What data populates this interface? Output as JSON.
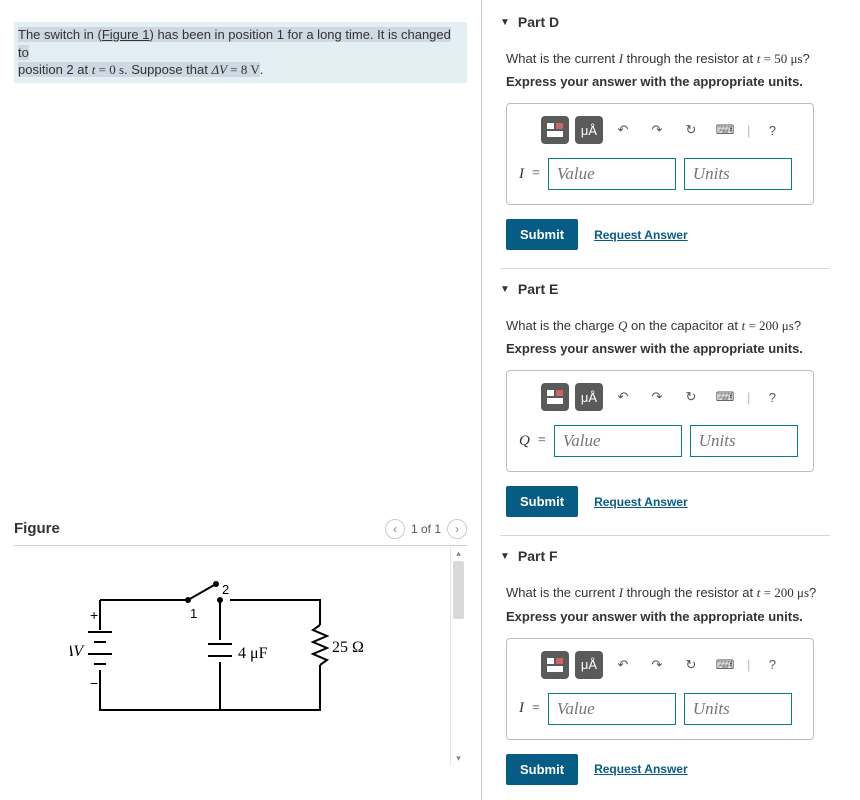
{
  "problem": {
    "seg1": "The switch in (",
    "figlink": "Figure 1",
    "seg2": ") has been in position 1 for a long time. It is changed to",
    "line2a": "position 2 at ",
    "eq1_lhs": "t",
    "eq1_rhs": "0 s",
    "line2b": ". Suppose that ",
    "eq2_lhs": "ΔV",
    "eq2_rhs": "8 V",
    "line2c": "."
  },
  "figure": {
    "title": "Figure",
    "page": "1 of 1",
    "deltaV": "ΔV",
    "switch_pos1": "1",
    "switch_pos2": "2",
    "cap": "4 μF",
    "res": "25 Ω",
    "plus": "+",
    "minus": "−"
  },
  "toolbar": {
    "units_symbol": "μÅ",
    "help": "?"
  },
  "input": {
    "value_ph": "Value",
    "units_ph": "Units"
  },
  "actions": {
    "submit": "Submit",
    "request": "Request Answer"
  },
  "parts": [
    {
      "label": "Part D",
      "var": "I",
      "q_pre": "What is the current ",
      "q_mid": " through the resistor at ",
      "t_val": "50 μs",
      "q_end": "?",
      "instr": "Express your answer with the appropriate units."
    },
    {
      "label": "Part E",
      "var": "Q",
      "q_pre": "What is the charge ",
      "q_mid": " on the capacitor at ",
      "t_val": "200 μs",
      "q_end": "?",
      "instr": "Express your answer with the appropriate units."
    },
    {
      "label": "Part F",
      "var": "I",
      "q_pre": "What is the current ",
      "q_mid": " through the resistor at ",
      "t_val": "200 μs",
      "q_end": "?",
      "instr": "Express your answer with the appropriate units."
    }
  ]
}
